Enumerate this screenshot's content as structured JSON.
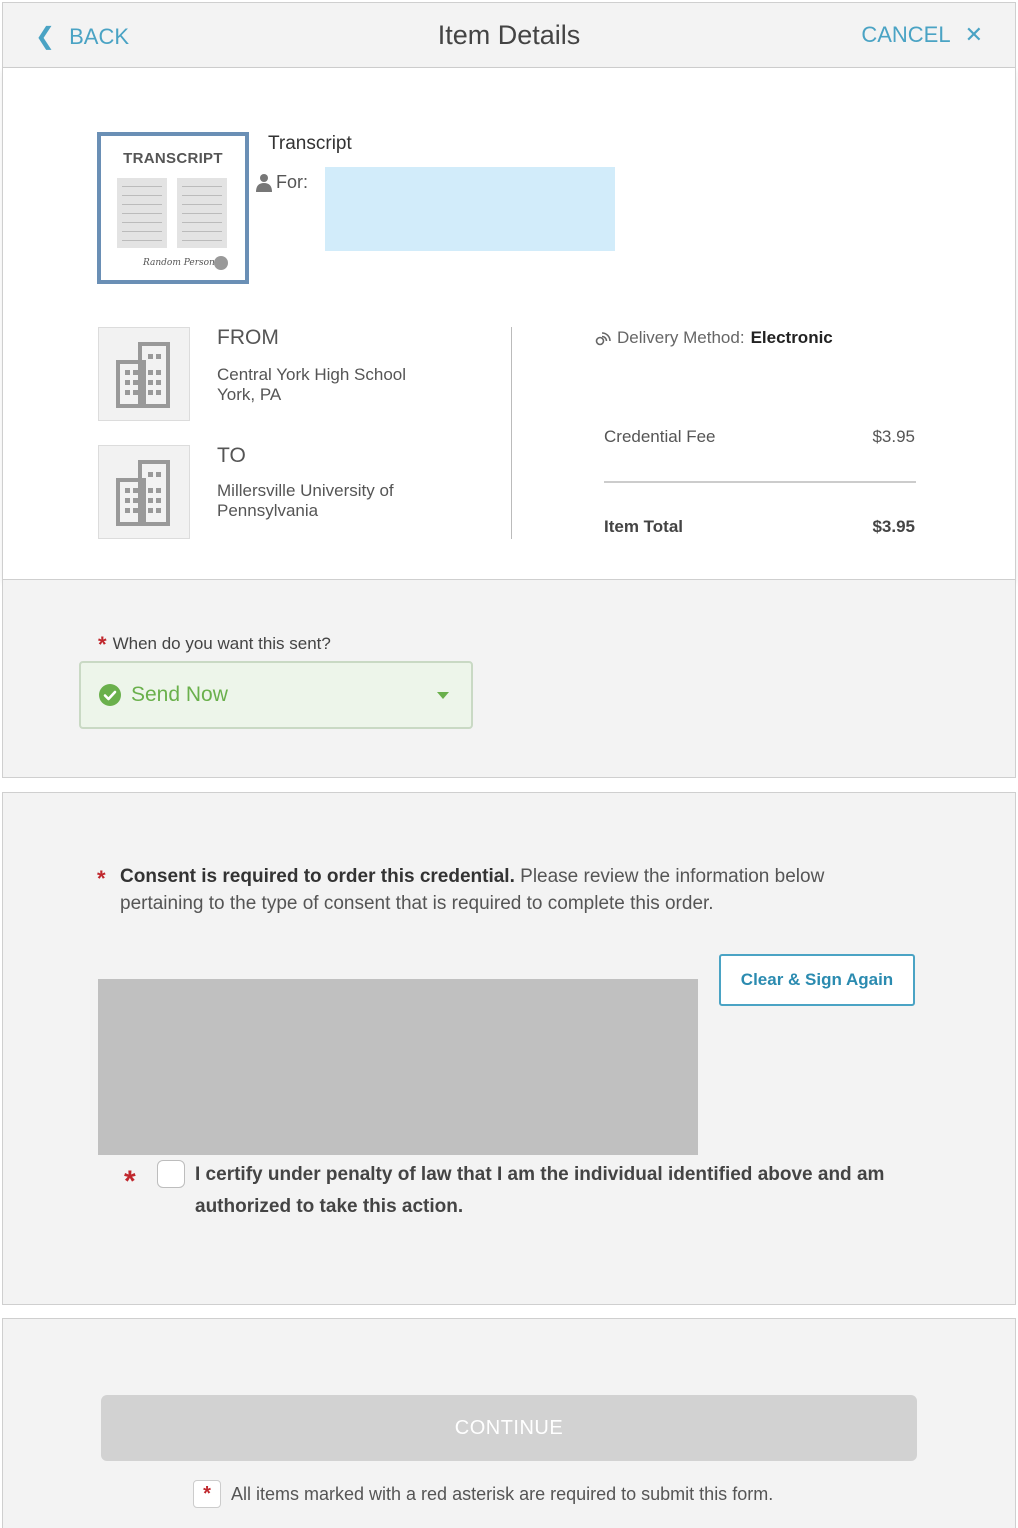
{
  "header": {
    "back_label": "BACK",
    "title": "Item Details",
    "cancel_label": "CANCEL"
  },
  "item": {
    "thumbnail_title": "TRANSCRIPT",
    "thumbnail_signature": "Random Person",
    "credential_name": "Transcript",
    "for_label": "For:",
    "from_label": "FROM",
    "from_line1": "Central York High School",
    "from_line2": "York, PA",
    "to_label": "TO",
    "to_line1": "Millersville University of",
    "to_line2": "Pennsylvania",
    "delivery_label": "Delivery Method:",
    "delivery_value": "Electronic",
    "fee_label": "Credential Fee",
    "fee_value": "$3.95",
    "total_label": "Item Total",
    "total_value": "$3.95"
  },
  "when": {
    "question": "When do you want this sent?",
    "selected": "Send Now"
  },
  "consent": {
    "bold": "Consent is required to order this credential.",
    "text": "Please review the information below pertaining to the type of consent that is required to complete this order.",
    "clear_button": "Clear & Sign Again",
    "certify_text": "I certify under penalty of law that I am the individual identified above and am authorized to take this action."
  },
  "footer": {
    "continue_label": "CONTINUE",
    "note": "All items marked with a red asterisk are required to submit this form."
  },
  "colors": {
    "accent": "#4aa3c4",
    "required": "#c0272d",
    "success": "#6ab04c"
  }
}
